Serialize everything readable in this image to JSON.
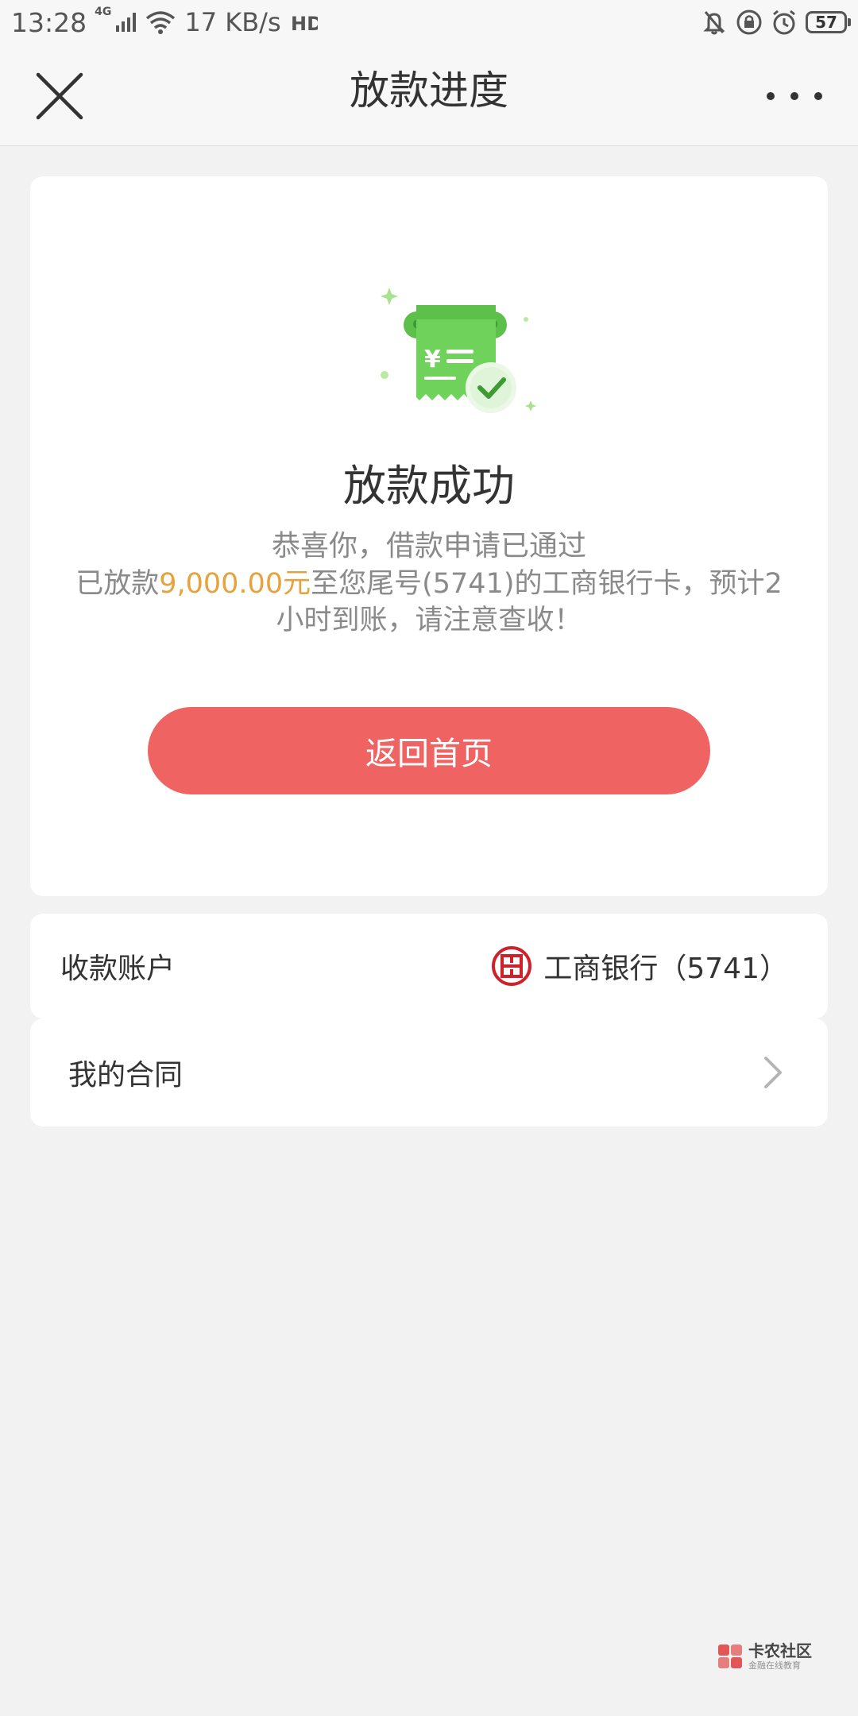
{
  "status_bar": {
    "time": "13:28",
    "network": "4G",
    "speed": "17 KB/s",
    "hd": "HD",
    "battery": "57"
  },
  "title_bar": {
    "title": "放款进度",
    "close_icon": "close-icon",
    "more_icon": "more-horizontal-icon"
  },
  "result": {
    "title": "放款成功",
    "subtitle": "恭喜你，借款申请已通过",
    "detail_prefix": "已放款",
    "amount": "9,000.00元",
    "detail_suffix": "至您尾号(5741)的工商银行卡，预计2小时到账，请注意查收！",
    "button_label": "返回首页"
  },
  "account": {
    "label": "收款账户",
    "bank": "工商银行（5741）",
    "bank_icon": "icbc-logo-icon"
  },
  "contract": {
    "label": "我的合同",
    "chevron_icon": "chevron-right-icon"
  },
  "watermark": {
    "main": "卡农社区",
    "sub": "金融在线教育"
  },
  "colors": {
    "accent": "#ef6363",
    "amount": "#e6a23c",
    "success_green": "#5cc04a",
    "background": "#f2f2f3"
  }
}
